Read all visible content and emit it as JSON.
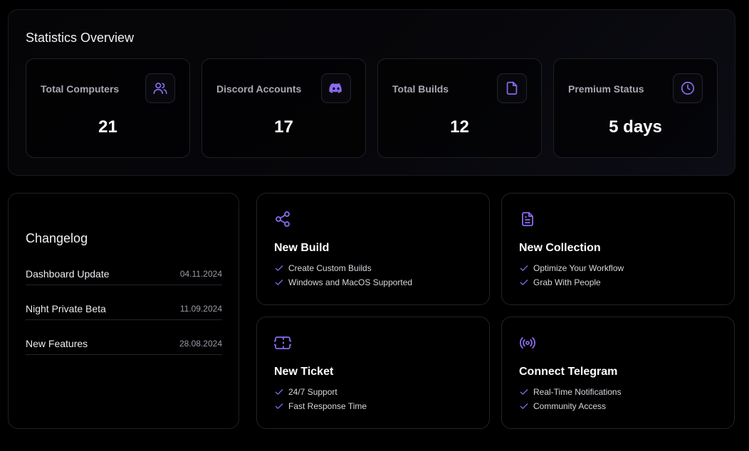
{
  "colors": {
    "accent": "#8b6cf0",
    "background": "#000000",
    "border": "#1f1f28"
  },
  "stats": {
    "title": "Statistics Overview",
    "cards": [
      {
        "label": "Total Computers",
        "value": "21",
        "icon": "users-icon"
      },
      {
        "label": "Discord Accounts",
        "value": "17",
        "icon": "discord-icon"
      },
      {
        "label": "Total Builds",
        "value": "12",
        "icon": "file-icon"
      },
      {
        "label": "Premium Status",
        "value": "5 days",
        "icon": "clock-icon"
      }
    ]
  },
  "changelog": {
    "title": "Changelog",
    "items": [
      {
        "name": "Dashboard Update",
        "date": "04.11.2024"
      },
      {
        "name": "Night Private Beta",
        "date": "11.09.2024"
      },
      {
        "name": "New Features",
        "date": "28.08.2024"
      }
    ]
  },
  "actions": [
    {
      "title": "New Build",
      "icon": "share-icon",
      "features": [
        "Create Custom Builds",
        "Windows and MacOS Supported"
      ]
    },
    {
      "title": "New Collection",
      "icon": "document-icon",
      "features": [
        "Optimize Your Workflow",
        "Grab With People"
      ]
    },
    {
      "title": "New Ticket",
      "icon": "ticket-icon",
      "features": [
        "24/7 Support",
        "Fast Response Time"
      ]
    },
    {
      "title": "Connect Telegram",
      "icon": "broadcast-icon",
      "features": [
        "Real-Time Notifications",
        "Community Access"
      ]
    }
  ]
}
